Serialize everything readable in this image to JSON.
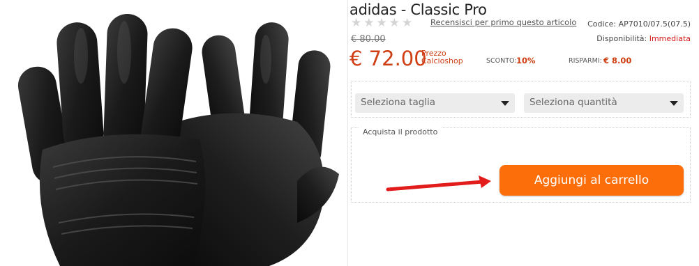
{
  "product": {
    "title": "adidas - Classic Pro",
    "image_alt": "Black goalkeeper gloves",
    "rating": {
      "stars_total": 5,
      "stars_filled": 0,
      "review_link": "Recensisci per primo questo articolo"
    },
    "code_label": "Codice:",
    "code_value": "AP7010/07.5(07.5)",
    "availability_label": "Disponibilità:",
    "availability_value": "Immediata",
    "old_price": "€ 80.00",
    "price": "€ 72.00",
    "price_note_line1": "Prezzo",
    "price_note_line2": "Calcioshop",
    "discount_label": "SCONTO:",
    "discount_value": "10%",
    "savings_label": "RISPARMI:",
    "savings_value": "€ 8.00"
  },
  "options": {
    "size_select": "Seleziona taglia",
    "quantity_select": "Seleziona quantità"
  },
  "purchase": {
    "section_label": "Acquista il prodotto",
    "add_to_cart": "Aggiungi al carrello"
  },
  "colors": {
    "accent_orange": "#fb6e0a",
    "price_red": "#cf3e13",
    "availability_red": "#d61a1a",
    "annotation_arrow": "#e21b1b"
  },
  "icons": {
    "star": "star-icon",
    "dropdown": "dropdown-arrow-icon",
    "annotation": "red-arrow-annotation"
  }
}
